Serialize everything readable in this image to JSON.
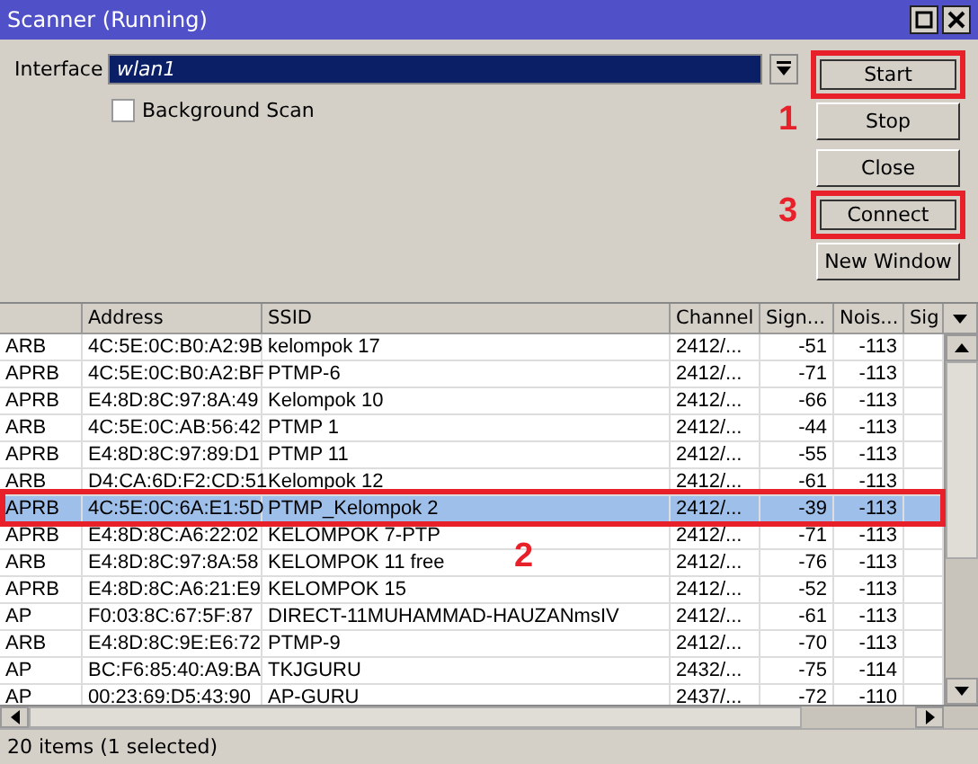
{
  "window": {
    "title": "Scanner (Running)"
  },
  "interface": {
    "label": "Interface",
    "value": "wlan1"
  },
  "background_scan": {
    "label": "Background Scan",
    "checked": false
  },
  "buttons": [
    {
      "label": "Start",
      "highlighted": true
    },
    {
      "label": "Stop",
      "highlighted": false
    },
    {
      "label": "Close",
      "highlighted": false
    },
    {
      "label": "Connect",
      "highlighted": true
    },
    {
      "label": "New Window",
      "highlighted": false
    }
  ],
  "annotations": [
    {
      "text": "1"
    },
    {
      "text": "3"
    },
    {
      "text": "2",
      "framed": true
    }
  ],
  "table": {
    "columns": [
      "",
      "Address",
      "SSID",
      "Channel",
      "Sign...",
      "Nois...",
      "Sig"
    ],
    "rows": [
      {
        "cells": [
          "ARB",
          "4C:5E:0C:B0:A2:9B",
          "kelompok 17",
          "2412/...",
          "-51",
          "-113"
        ],
        "selected": false
      },
      {
        "cells": [
          "APRB",
          "4C:5E:0C:B0:A2:BF",
          "PTMP-6",
          "2412/...",
          "-71",
          "-113"
        ],
        "selected": false
      },
      {
        "cells": [
          "APRB",
          "E4:8D:8C:97:8A:49",
          "Kelompok 10",
          "2412/...",
          "-66",
          "-113"
        ],
        "selected": false
      },
      {
        "cells": [
          "ARB",
          "4C:5E:0C:AB:56:42",
          "PTMP 1",
          "2412/...",
          "-44",
          "-113"
        ],
        "selected": false
      },
      {
        "cells": [
          "APRB",
          "E4:8D:8C:97:89:D1",
          "PTMP 11",
          "2412/...",
          "-55",
          "-113"
        ],
        "selected": false
      },
      {
        "cells": [
          "ARB",
          "D4:CA:6D:F2:CD:51",
          "Kelompok 12",
          "2412/...",
          "-61",
          "-113"
        ],
        "selected": false
      },
      {
        "cells": [
          "APRB",
          "4C:5E:0C:6A:E1:5D",
          "PTMP_Kelompok  2",
          "2412/...",
          "-39",
          "-113"
        ],
        "selected": true
      },
      {
        "cells": [
          "APRB",
          "E4:8D:8C:A6:22:02",
          "KELOMPOK 7-PTP",
          "2412/...",
          "-71",
          "-113"
        ],
        "selected": false
      },
      {
        "cells": [
          "ARB",
          "E4:8D:8C:97:8A:58",
          "KELOMPOK 11 free",
          "2412/...",
          "-76",
          "-113"
        ],
        "selected": false
      },
      {
        "cells": [
          "APRB",
          "E4:8D:8C:A6:21:E9",
          "KELOMPOK 15",
          "2412/...",
          "-52",
          "-113"
        ],
        "selected": false
      },
      {
        "cells": [
          "AP",
          "F0:03:8C:67:5F:87",
          "DIRECT-11MUHAMMAD-HAUZANmsIV",
          "2412/...",
          "-61",
          "-113"
        ],
        "selected": false
      },
      {
        "cells": [
          "ARB",
          "E4:8D:8C:9E:E6:72",
          "PTMP-9",
          "2412/...",
          "-70",
          "-113"
        ],
        "selected": false
      },
      {
        "cells": [
          "AP",
          "BC:F6:85:40:A9:BA",
          "TKJGURU",
          "2432/...",
          "-75",
          "-114"
        ],
        "selected": false
      },
      {
        "cells": [
          "AP",
          "00:23:69:D5:43:90",
          "AP-GURU",
          "2437/...",
          "-72",
          "-110"
        ],
        "selected": false
      }
    ]
  },
  "status_bar": {
    "text": "20 items (1 selected)"
  }
}
